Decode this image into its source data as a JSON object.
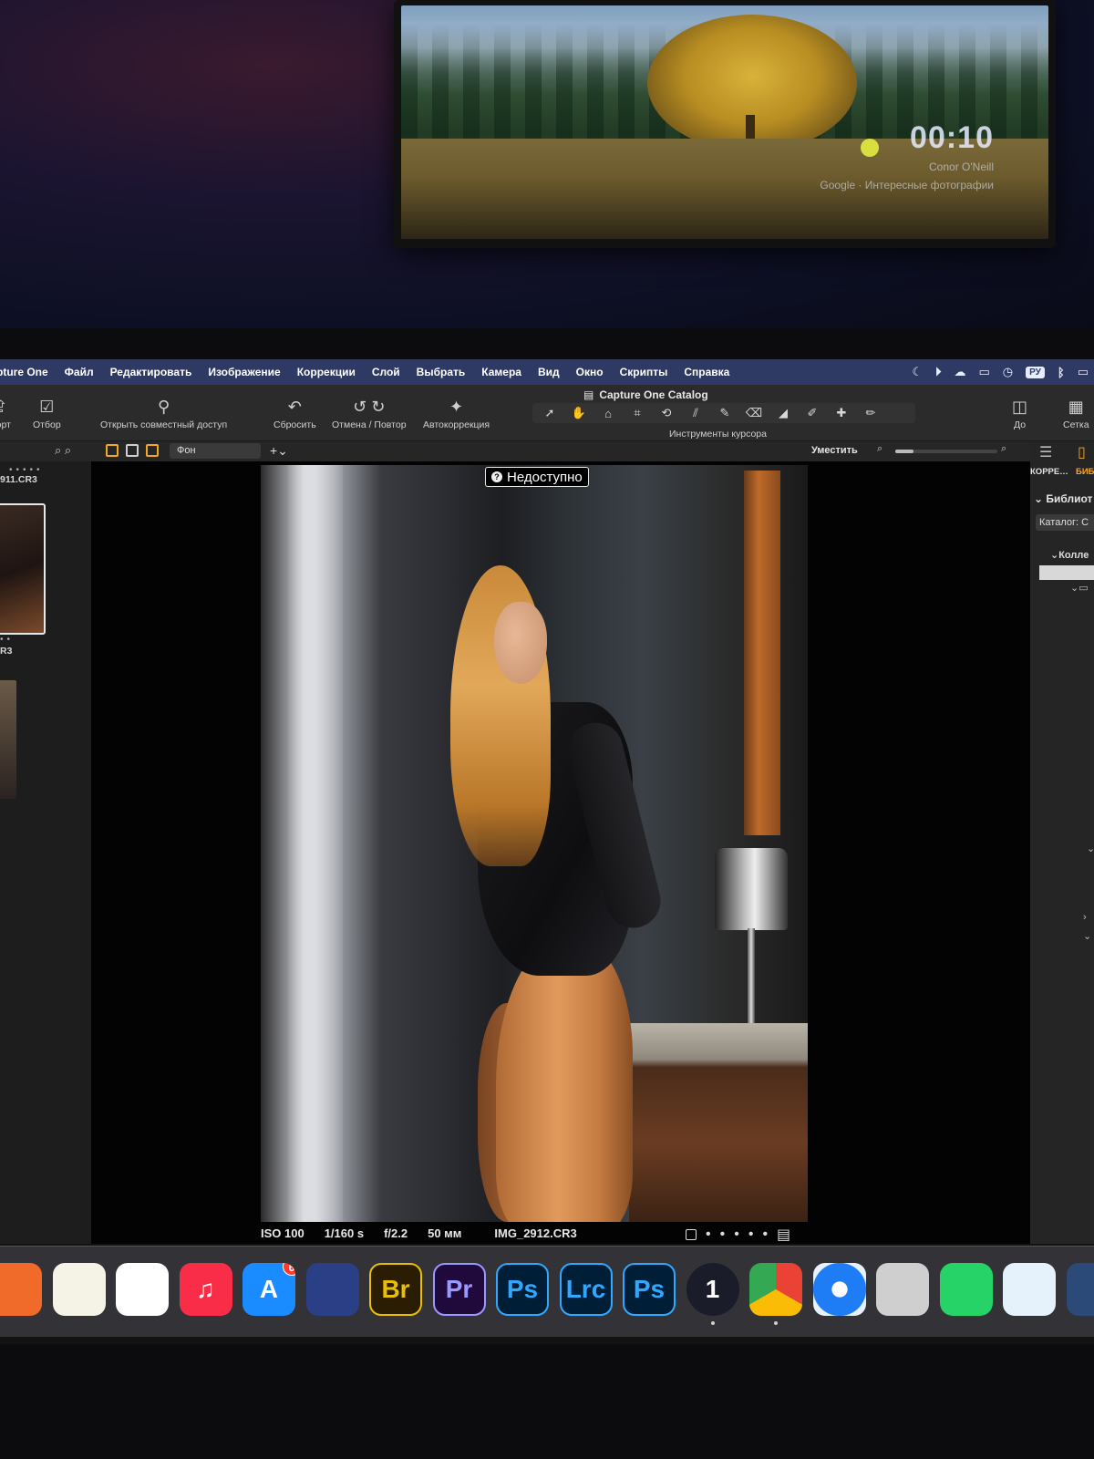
{
  "screensaver": {
    "time": "00:10",
    "author": "Conor O'Neill",
    "source": "Google · Интересные фотографии"
  },
  "menubar": {
    "items": [
      "pture One",
      "Файл",
      "Редактировать",
      "Изображение",
      "Коррекции",
      "Слой",
      "Выбрать",
      "Камера",
      "Вид",
      "Окно",
      "Скрипты",
      "Справка"
    ],
    "input_language": "РУ"
  },
  "toolbar": {
    "window_title": "Capture One Catalog",
    "buttons": {
      "export": "порт",
      "select": "Отбор",
      "share": "Открыть совместный доступ",
      "reset": "Сбросить",
      "undo_redo": "Отмена / Повтор",
      "auto": "Автокоррекция",
      "before": "До",
      "grid": "Сетка"
    },
    "cursor_tools_label": "Инструменты курсора"
  },
  "viewerbar": {
    "layer_select": "Фон",
    "fit_label": "Уместить",
    "zoom_fraction": 0.18
  },
  "browser": {
    "thumb1_name": "911.CR3",
    "thumb2_name": "R3"
  },
  "viewer": {
    "unavailable_label": "Недоступно",
    "exif": {
      "iso": "ISO 100",
      "shutter": "1/160 s",
      "aperture": "f/2.2",
      "focal": "50 мм",
      "filename": "IMG_2912.CR3"
    }
  },
  "tool_panel": {
    "tab_adjust": "КОРРЕ…",
    "tab_library": "БИБ",
    "library_header": "Библиот",
    "catalog": "Каталог: С",
    "collections": "Колле"
  },
  "dock": {
    "items": [
      {
        "name": "photos",
        "label": "",
        "bg": "#f06a2a"
      },
      {
        "name": "notes",
        "label": "",
        "bg": "#f5f2e6"
      },
      {
        "name": "freeform",
        "label": "",
        "bg": "#ffffff"
      },
      {
        "name": "music",
        "label": "♫",
        "bg": "#fa2d48"
      },
      {
        "name": "app-store",
        "label": "A",
        "bg": "#1a8cff",
        "badge": "6"
      },
      {
        "name": "capture-one-settings",
        "label": "",
        "bg": "#2b3f86"
      },
      {
        "name": "bridge",
        "label": "Br",
        "bg": "#2a1d04"
      },
      {
        "name": "premiere",
        "label": "Pr",
        "bg": "#1f0a3b"
      },
      {
        "name": "photoshop-beta",
        "label": "Ps",
        "bg": "#001e36"
      },
      {
        "name": "lightroom-classic",
        "label": "Lrc",
        "bg": "#001e36"
      },
      {
        "name": "photoshop",
        "label": "Ps",
        "bg": "#001e36"
      },
      {
        "name": "capture-one",
        "label": "1",
        "bg": "#1a1c2a"
      },
      {
        "name": "chrome",
        "label": "",
        "bg": "#ffffff"
      },
      {
        "name": "safari",
        "label": "",
        "bg": "#e8f2ff"
      },
      {
        "name": "image-capture",
        "label": "",
        "bg": "#cfcfcf"
      },
      {
        "name": "whatsapp",
        "label": "",
        "bg": "#25d366"
      },
      {
        "name": "telegram",
        "label": "",
        "bg": "#e6f2fb"
      },
      {
        "name": "quicktime",
        "label": "",
        "bg": "#2b4a78"
      }
    ]
  }
}
